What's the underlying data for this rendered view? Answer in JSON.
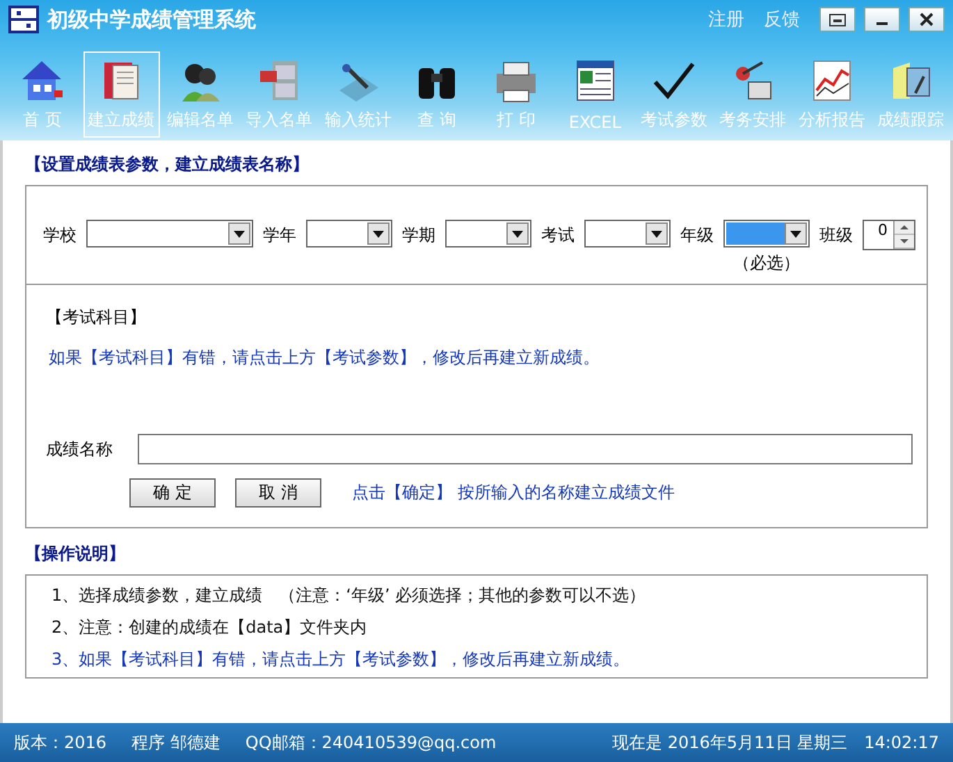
{
  "window": {
    "title": "初级中学成绩管理系统",
    "links": [
      "注册",
      "反馈"
    ]
  },
  "toolbar": [
    {
      "label": "首 页",
      "kind": "house",
      "selected": false
    },
    {
      "label": "建立成绩",
      "kind": "book",
      "selected": true
    },
    {
      "label": "编辑名单",
      "kind": "people",
      "selected": false
    },
    {
      "label": "导入名单",
      "kind": "cabinet",
      "selected": false
    },
    {
      "label": "输入统计",
      "kind": "pen",
      "selected": false
    },
    {
      "label": "查 询",
      "kind": "binoculars",
      "selected": false
    },
    {
      "label": "打 印",
      "kind": "printer",
      "selected": false
    },
    {
      "label": "EXCEL",
      "kind": "sheet",
      "selected": false
    },
    {
      "label": "考试参数",
      "kind": "check",
      "selected": false
    },
    {
      "label": "考务安排",
      "kind": "desk",
      "selected": false
    },
    {
      "label": "分析报告",
      "kind": "chart",
      "selected": false
    },
    {
      "label": "成绩跟踪",
      "kind": "folder",
      "selected": false
    }
  ],
  "params": {
    "heading": "【设置成绩表参数，建立成绩表名称】",
    "fields": [
      {
        "label": "学校",
        "kind": "select",
        "highlighted": false
      },
      {
        "label": "学年",
        "kind": "select",
        "highlighted": false
      },
      {
        "label": "学期",
        "kind": "select",
        "highlighted": false
      },
      {
        "label": "考试",
        "kind": "select",
        "highlighted": false
      },
      {
        "label": "年级",
        "kind": "select",
        "highlighted": true,
        "note": "（必选）"
      },
      {
        "label": "班级",
        "kind": "spinner",
        "value": "0"
      }
    ]
  },
  "subjects": {
    "heading": "【考试科目】",
    "note": "如果【考试科目】有错，请点击上方【考试参数】，修改后再建立新成绩。",
    "name_label": "成绩名称",
    "buttons": [
      "确 定",
      "取 消"
    ],
    "hint": "点击【确定】 按所输入的名称建立成绩文件"
  },
  "instructions": {
    "heading": "【操作说明】",
    "lines": [
      {
        "text": "1、选择成绩参数，建立成绩　（注意：‘年级’ 必须选择；其他的参数可以不选）",
        "kind": "plain"
      },
      {
        "text": "2、注意：创建的成绩在【data】文件夹内",
        "kind": "plain"
      },
      {
        "text": "3、如果【考试科目】有错，请点击上方【考试参数】，修改后再建立新成绩。",
        "kind": "accent"
      }
    ]
  },
  "status_bar": [
    "版本：2016",
    "程序 邹德建",
    "QQ邮箱：240410539@qq.com",
    "现在是 2016年5月11日 星期三　14:02:17"
  ]
}
